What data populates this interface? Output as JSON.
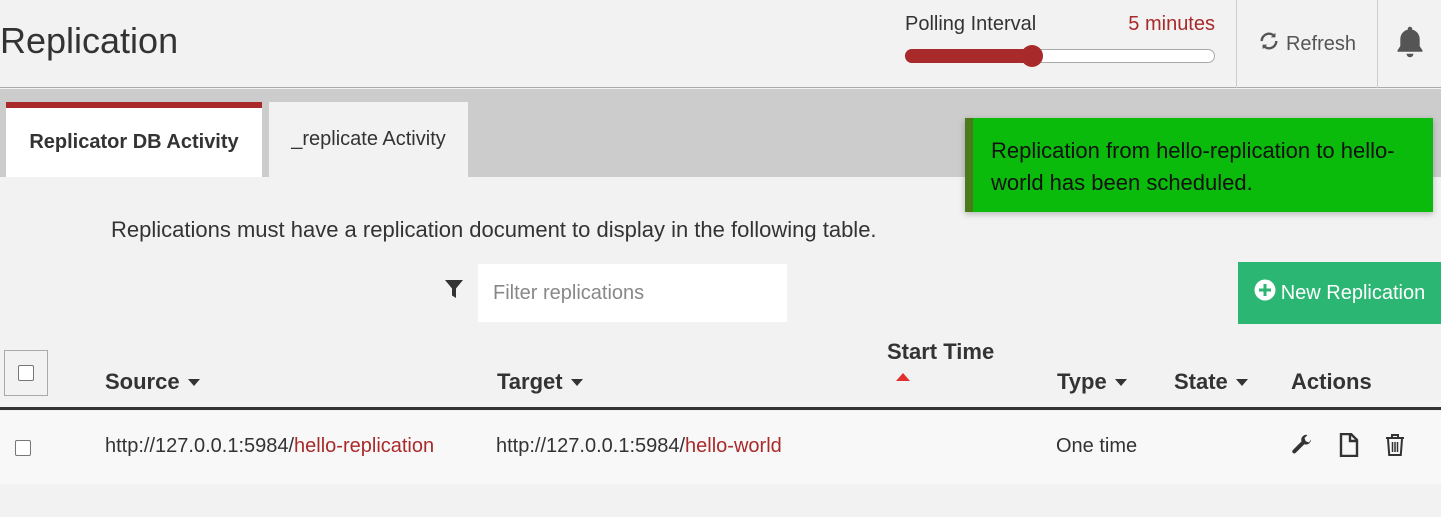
{
  "header": {
    "title": "Replication",
    "polling": {
      "label": "Polling Interval",
      "value_text": "5 minutes",
      "slider_fraction": 0.41
    },
    "refresh_label": "Refresh"
  },
  "tabs": [
    {
      "label": "Replicator DB Activity",
      "active": true
    },
    {
      "label": "_replicate Activity",
      "active": false
    }
  ],
  "toast": {
    "message": "Replication from hello-replication to hello-world has been scheduled.",
    "color": "#0bbb0b"
  },
  "info_text": "Replications must have a replication document to display in the following table.",
  "filter": {
    "placeholder": "Filter replications",
    "value": ""
  },
  "new_replication_label": "New Replication",
  "table": {
    "columns": {
      "source": "Source",
      "target": "Target",
      "start_time": "Start Time",
      "type": "Type",
      "state": "State",
      "actions": "Actions"
    },
    "rows": [
      {
        "source_host": "http://127.0.0.1:5984/",
        "source_db": "hello-replication",
        "target_host": "http://127.0.0.1:5984/",
        "target_db": "hello-world",
        "start_time": "",
        "type": "One time",
        "state": ""
      }
    ]
  },
  "colors": {
    "accent": "#a92a2a",
    "success": "#2bb673",
    "toast": "#0bbb0b"
  }
}
